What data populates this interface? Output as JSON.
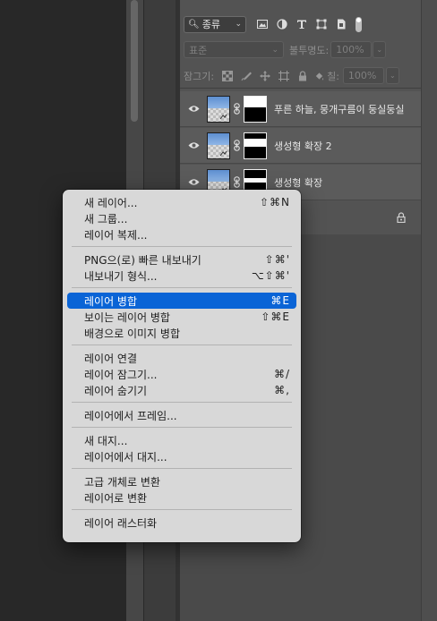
{
  "layers_panel": {
    "filter": {
      "kind_label": "종류"
    },
    "blend_mode": "표준",
    "opacity_label": "불투명도:",
    "opacity_value": "100%",
    "lock_label": "잠그기:",
    "fill_label": "칠:",
    "fill_value": "100%",
    "layers": [
      {
        "name": "푸른 하늘, 뭉개구름이 둥실둥실",
        "visible": true,
        "mask": "top-band"
      },
      {
        "name": "생성형 확장 2",
        "visible": true,
        "mask": "middle-band"
      },
      {
        "name": "생성형 확장",
        "visible": true,
        "mask": "thin-band"
      }
    ]
  },
  "context_menu": {
    "groups": [
      [
        {
          "label": "새 레이어...",
          "shortcut": "⇧⌘N"
        },
        {
          "label": "새 그룹...",
          "shortcut": ""
        },
        {
          "label": "레이어 복제...",
          "shortcut": ""
        }
      ],
      [
        {
          "label": "PNG으(로) 빠른 내보내기",
          "shortcut": "⇧⌘'"
        },
        {
          "label": "내보내기 형식...",
          "shortcut": "⌥⇧⌘'"
        }
      ],
      [
        {
          "label": "레이어 병합",
          "shortcut": "⌘E",
          "highlighted": true
        },
        {
          "label": "보이는 레이어 병합",
          "shortcut": "⇧⌘E"
        },
        {
          "label": "배경으로 이미지 병합",
          "shortcut": ""
        }
      ],
      [
        {
          "label": "레이어 연결",
          "shortcut": ""
        },
        {
          "label": "레이어 잠그기...",
          "shortcut": "⌘/"
        },
        {
          "label": "레이어 숨기기",
          "shortcut": "⌘,"
        }
      ],
      [
        {
          "label": "레이어에서 프레임...",
          "shortcut": ""
        }
      ],
      [
        {
          "label": "새 대지...",
          "shortcut": ""
        },
        {
          "label": "레이어에서 대지...",
          "shortcut": ""
        }
      ],
      [
        {
          "label": "고급 개체로 변환",
          "shortcut": ""
        },
        {
          "label": "레이어로 변환",
          "shortcut": ""
        }
      ],
      [
        {
          "label": "레이어 래스터화",
          "shortcut": ""
        }
      ]
    ]
  },
  "colors": {
    "highlight": "#0a64d6",
    "menu_bg": "#d8d8d8",
    "panel_bg": "#535353"
  }
}
